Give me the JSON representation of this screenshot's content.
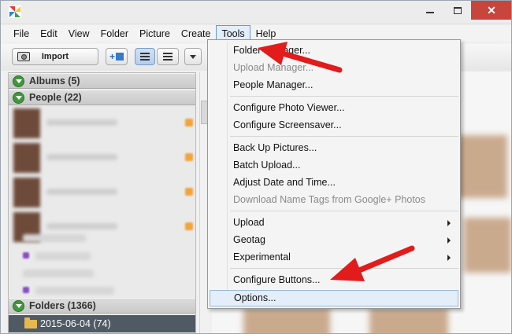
{
  "menubar": {
    "items": [
      {
        "label": "File"
      },
      {
        "label": "Edit"
      },
      {
        "label": "View"
      },
      {
        "label": "Folder"
      },
      {
        "label": "Picture"
      },
      {
        "label": "Create"
      },
      {
        "label": "Tools"
      },
      {
        "label": "Help"
      }
    ],
    "active": "Tools"
  },
  "toolbar": {
    "import_label": "Import"
  },
  "left_panel": {
    "albums": "Albums (5)",
    "people": "People (22)",
    "folders": "Folders (1366)",
    "selected_folder": "2015-06-04 (74)"
  },
  "tools_menu": {
    "items": [
      {
        "label": "Folder Manager...",
        "disabled": false
      },
      {
        "label": "Upload Manager...",
        "disabled": true
      },
      {
        "label": "People Manager...",
        "disabled": false
      },
      {
        "label": "Configure Photo Viewer...",
        "disabled": false
      },
      {
        "label": "Configure Screensaver...",
        "disabled": false
      },
      {
        "label": "Back Up Pictures...",
        "disabled": false
      },
      {
        "label": "Batch Upload...",
        "disabled": false
      },
      {
        "label": "Adjust Date and Time...",
        "disabled": false
      },
      {
        "label": "Download Name Tags from Google+ Photos",
        "disabled": true
      },
      {
        "label": "Upload",
        "disabled": false,
        "submenu": true
      },
      {
        "label": "Geotag",
        "disabled": false,
        "submenu": true
      },
      {
        "label": "Experimental",
        "disabled": false,
        "submenu": true
      },
      {
        "label": "Configure Buttons...",
        "disabled": false
      },
      {
        "label": "Options...",
        "disabled": false,
        "highlighted": true
      }
    ]
  },
  "colors": {
    "annotation_arrow": "#e21b1b",
    "menu_highlight": "#e4eef9",
    "selected_folder_bg": "#4f5a64",
    "section_chevron": "#3f9a3a"
  },
  "icons": {
    "app": "picasa-logo-icon",
    "import": "camera-icon",
    "folder": "folder-icon"
  }
}
